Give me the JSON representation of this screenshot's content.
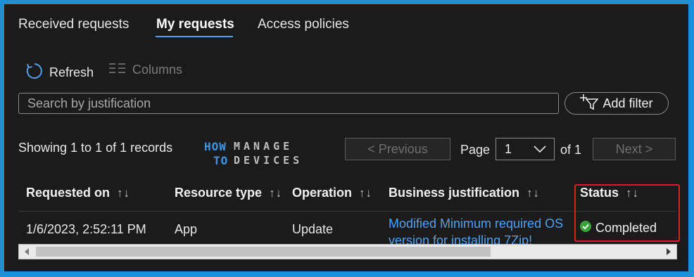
{
  "tabs": [
    {
      "label": "Received requests"
    },
    {
      "label": "My requests"
    },
    {
      "label": "Access policies"
    }
  ],
  "toolbar": {
    "refresh": "Refresh",
    "columns": "Columns"
  },
  "search": {
    "placeholder": "Search by justification",
    "value": ""
  },
  "filter": {
    "add_label": "Add filter"
  },
  "records_text": "Showing 1 to 1 of 1 records",
  "watermark": {
    "how": "HOW",
    "to": "TO",
    "manage": "MANAGE",
    "devices": "DEVICES"
  },
  "pager": {
    "previous": "< Previous",
    "page_label": "Page",
    "page_value": "1",
    "of_label": "of 1",
    "next": "Next >"
  },
  "table": {
    "columns": [
      "Requested on",
      "Resource type",
      "Operation",
      "Business justification",
      "Status"
    ],
    "sort_glyph": "↑↓",
    "rows": [
      {
        "requested_on": "1/6/2023, 2:52:11 PM",
        "resource_type": "App",
        "operation": "Update",
        "justification": "Modified Minimum required OS version for installing 7Zip!",
        "status": "Completed"
      }
    ]
  },
  "colors": {
    "accent": "#4ea1f0",
    "success": "#3aa23a",
    "highlight": "#d9201f",
    "frame": "#1f8fd6"
  }
}
